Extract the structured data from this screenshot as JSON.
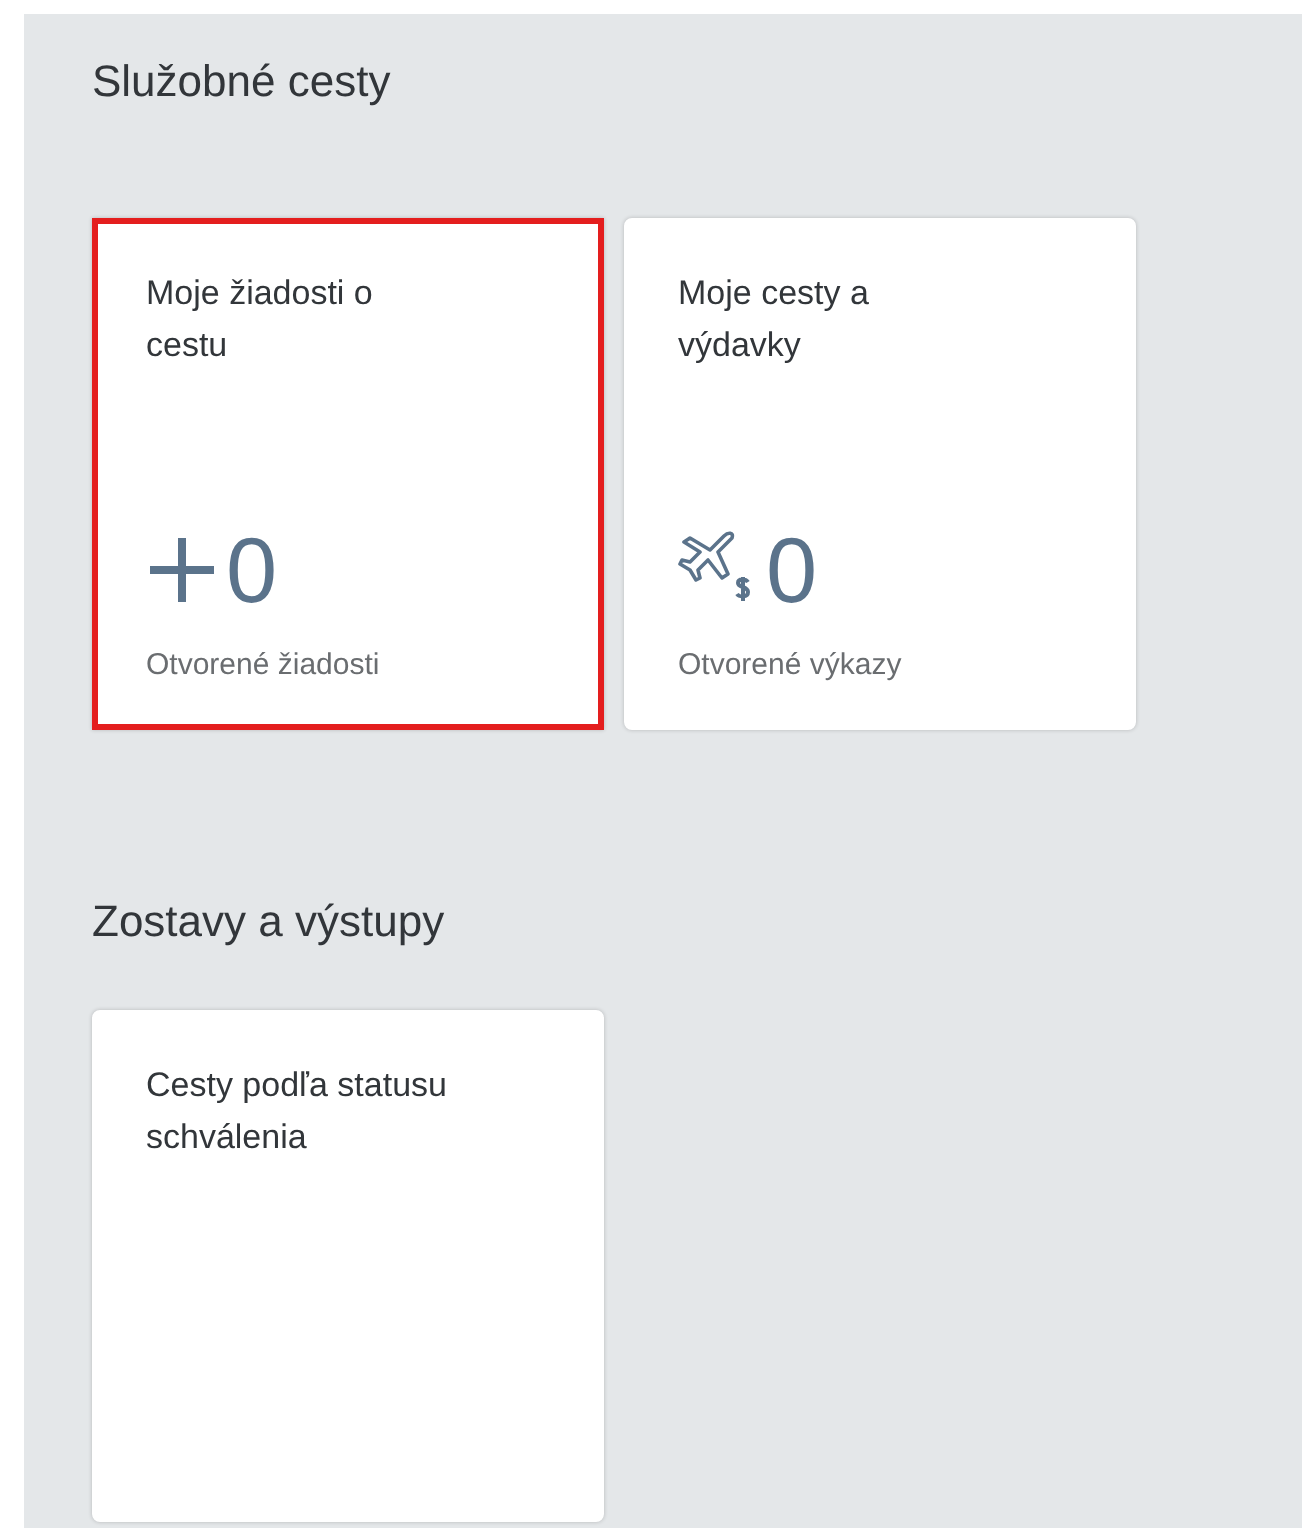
{
  "sections": [
    {
      "title": "Služobné cesty",
      "tiles": [
        {
          "kind": "request",
          "title": "Moje žiadosti o cestu",
          "value": "0",
          "footer": "Otvorené žiadosti",
          "highlighted": true
        },
        {
          "kind": "expense",
          "title": "Moje cesty a výdavky",
          "value": "0",
          "footer": "Otvorené výkazy",
          "highlighted": false
        }
      ]
    },
    {
      "title": "Zostavy a výstupy",
      "tiles": [
        {
          "kind": "report",
          "title": "Cesty podľa statusu schválenia",
          "highlighted": false
        }
      ]
    }
  ]
}
